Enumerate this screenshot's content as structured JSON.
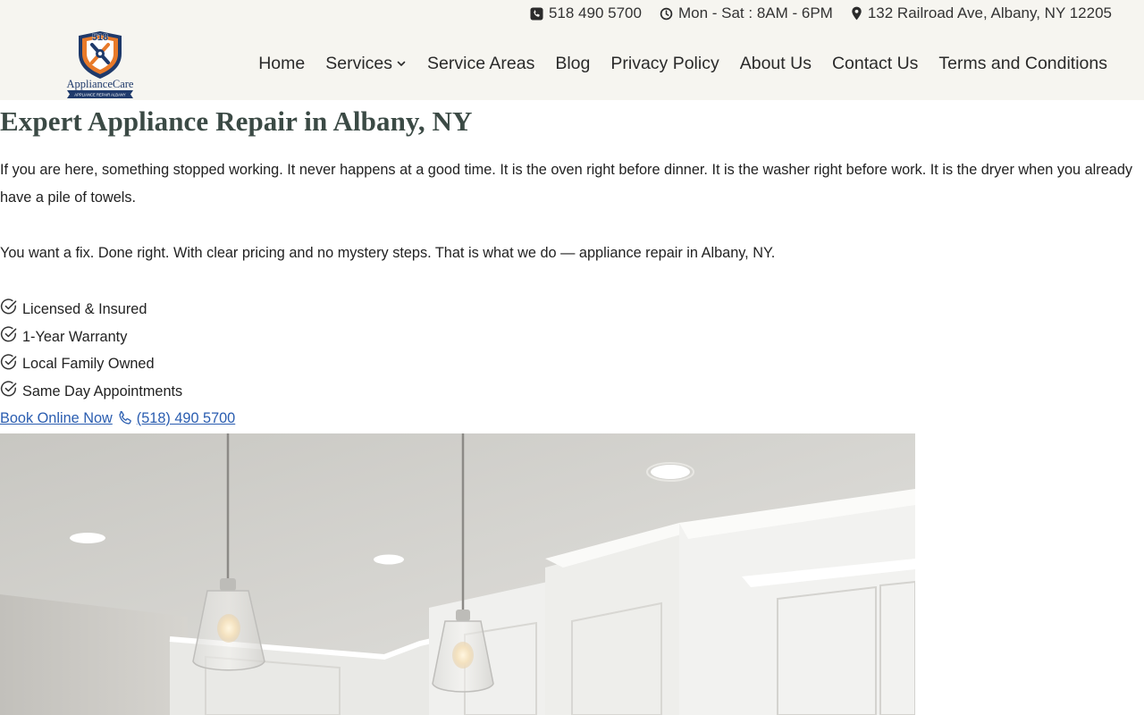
{
  "topbar": {
    "phone": "518 490 5700",
    "hours": "Mon - Sat : 8AM - 6PM",
    "address": "132 Railroad Ave, Albany, NY 12205"
  },
  "logo": {
    "number": "518",
    "name": "ApplianceCare",
    "tagline": "APPLIANCE REPAIR ALBANY"
  },
  "nav": {
    "items": [
      "Home",
      "Services",
      "Service Areas",
      "Blog",
      "Privacy Policy",
      "About Us",
      "Contact Us",
      "Terms and Conditions"
    ]
  },
  "main": {
    "title": "Expert Appliance Repair in Albany, NY",
    "paragraph1": "If you are here, something stopped working. It never happens at a good time. It is the oven right before dinner. It is the washer right before work. It is the dryer when you already have a pile of towels.",
    "paragraph2": "You want a fix. Done right. With clear pricing and no mystery steps. That is what we do — appliance repair in Albany, NY.",
    "features": [
      "Licensed & Insured",
      "1-Year Warranty",
      "Local Family Owned",
      "Same Day Appointments"
    ],
    "cta": {
      "book_label": "Book Online Now",
      "phone_label": " (518) 490 5700"
    }
  },
  "colors": {
    "header_bg": "#f6f5f0",
    "headline": "#3b4a45",
    "link": "#2a5db0",
    "logo_orange": "#e87a2a",
    "logo_navy": "#1f3a6b"
  },
  "icons": {
    "phone": "phone-icon",
    "hours": "clock-icon",
    "address": "map-pin-icon",
    "check": "circle-check-icon",
    "cta_phone": "phone-outline-icon",
    "services_dropdown": "chevron-down-icon"
  }
}
